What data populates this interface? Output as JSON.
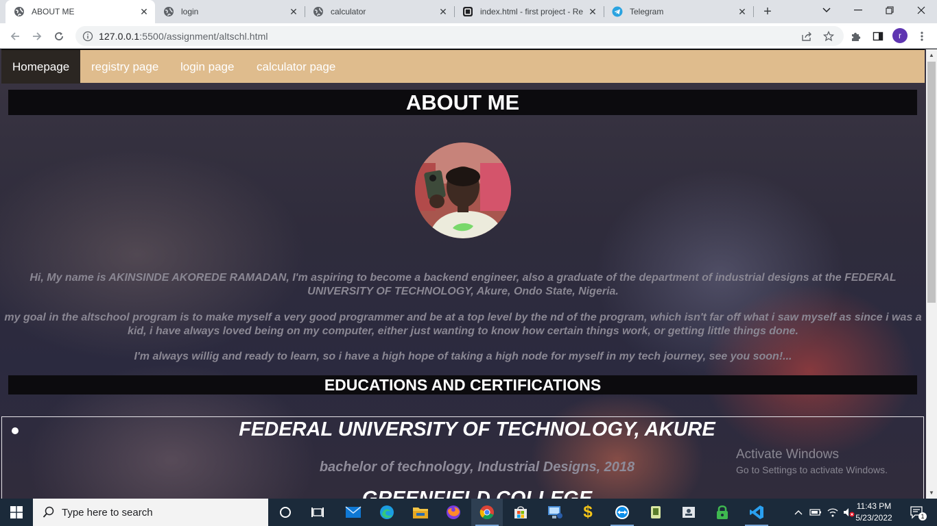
{
  "browser": {
    "tabs": [
      {
        "title": "ABOUT ME",
        "icon": "globe-icon",
        "active": true
      },
      {
        "title": "login",
        "icon": "globe-icon",
        "active": false
      },
      {
        "title": "calculator",
        "icon": "globe-icon",
        "active": false
      },
      {
        "title": "index.html - first project - Re",
        "icon": "replit-icon",
        "active": false
      },
      {
        "title": "Telegram",
        "icon": "telegram-icon",
        "active": false
      }
    ],
    "url_host": "127.0.0.1",
    "url_path": ":5500/assignment/altschl.html",
    "profile_initial": "r"
  },
  "page": {
    "nav": [
      "Homepage",
      "registry page",
      "login page",
      "calculator page"
    ],
    "about_heading": "ABOUT ME",
    "paragraphs": [
      "Hi, My name is AKINSINDE AKOREDE RAMADAN, I'm aspiring to become a backend engineer, also a graduate of the department of industrial designs at the FEDERAL UNIVERSITY OF TECHNOLOGY, Akure, Ondo State, Nigeria.",
      "my goal in the altschool program is to make myself a very good programmer and be at a top level by the nd of the program, which isn't far off what i saw myself as since i was a kid, i have always loved being on my computer, either just wanting to know how certain things work, or getting little things done.",
      "I'm always willig and ready to learn, so i have a high hope of taking a high node for myself in my tech journey, see you soon!..."
    ],
    "education_heading": "EDUCATIONS AND CERTIFICATIONS",
    "education": [
      {
        "school": "FEDERAL UNIVERSITY OF TECHNOLOGY, AKURE",
        "detail": "bachelor of technology, Industrial Designs, 2018"
      },
      {
        "school": "GREENFIELD COLLEGE",
        "detail": ""
      }
    ]
  },
  "watermark": {
    "title": "Activate Windows",
    "subtitle": "Go to Settings to activate Windows."
  },
  "taskbar": {
    "search_placeholder": "Type here to search",
    "time": "11:43 PM",
    "date": "5/23/2022",
    "notification_count": "1"
  },
  "colors": {
    "nav_bar": "#dfbc8d",
    "nav_active": "#2b2622",
    "heading_bg": "#0c0b0e",
    "paragraph_text": "#8a8793",
    "taskbar": "#1b2a3a"
  }
}
